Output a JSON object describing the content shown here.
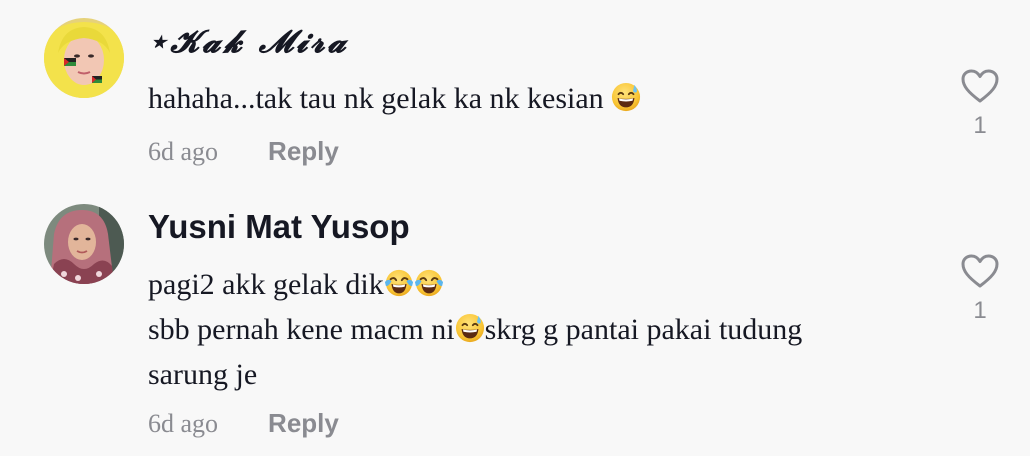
{
  "comments": [
    {
      "username": "⋆𝓚𝓪𝓴 𝓜𝓲𝓻𝓪",
      "lines": [
        {
          "text": "hahaha...tak tau nk gelak ka nk kesian",
          "emojis": [
            "grinning-sweat-emoji"
          ]
        }
      ],
      "time": "6d ago",
      "reply_label": "Reply",
      "like_count": "1",
      "like_icon": "heart-outline-icon"
    },
    {
      "username": "Yusni Mat Yusop",
      "lines": [
        {
          "text": "pagi2 akk gelak dik",
          "emojis": [
            "tears-of-joy-emoji",
            "tears-of-joy-emoji"
          ]
        },
        {
          "text_before": "sbb pernah kene macm ni",
          "emoji": "grinning-sweat-emoji",
          "text_after": "skrg g pantai pakai tudung"
        },
        {
          "text": "sarung je"
        }
      ],
      "time": "6d ago",
      "reply_label": "Reply",
      "like_count": "1",
      "like_icon": "heart-outline-icon"
    }
  ],
  "colors": {
    "background": "#f8f8f8",
    "primary_text": "#161823",
    "secondary_text": "#8a8b91"
  }
}
